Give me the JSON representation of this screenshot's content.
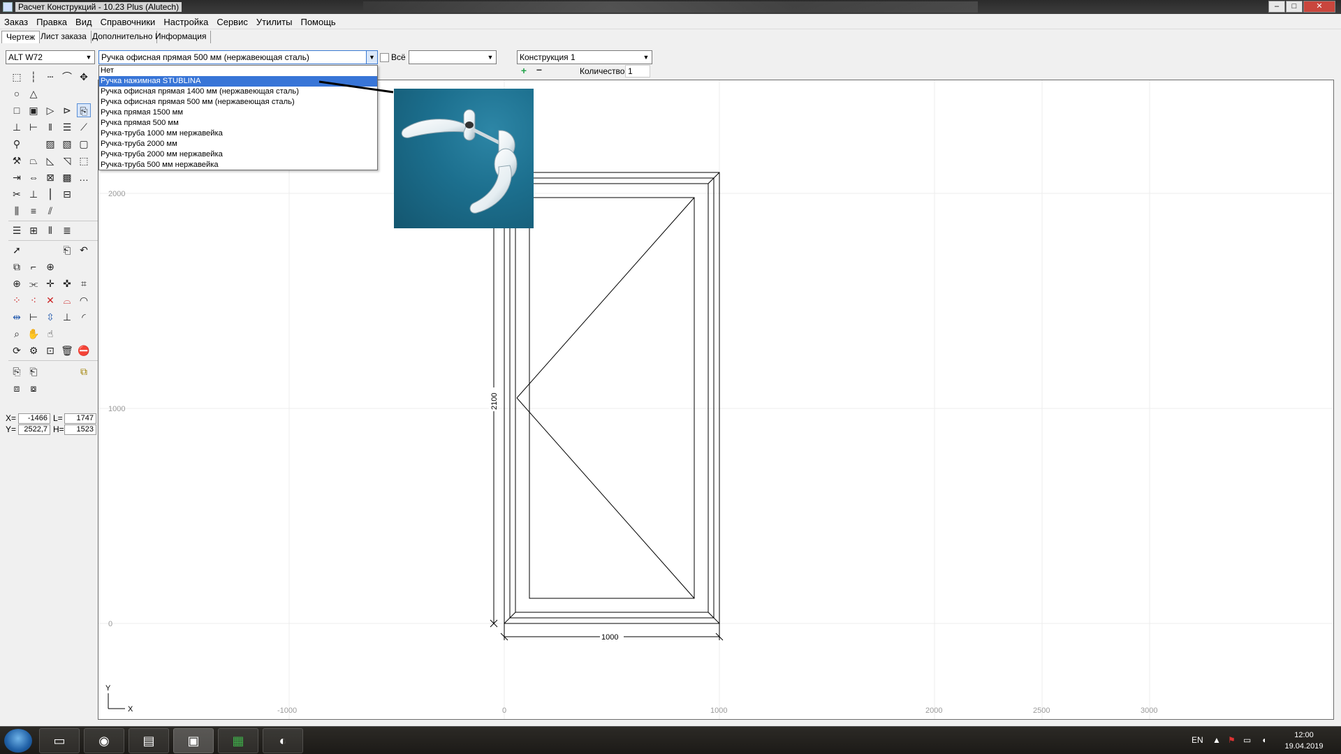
{
  "window": {
    "title": "Расчет Конструкций - 10.23 Plus (Alutech)",
    "min_glyph": "–",
    "max_glyph": "□",
    "close_glyph": "✕"
  },
  "menu": [
    "Заказ",
    "Правка",
    "Вид",
    "Справочники",
    "Настройка",
    "Сервис",
    "Утилиты",
    "Помощь"
  ],
  "tabs": [
    {
      "label": "Чертеж",
      "active": true
    },
    {
      "label": "Лист заказа",
      "active": false
    },
    {
      "label": "Дополнительно",
      "active": false
    },
    {
      "label": "Информация",
      "active": false
    }
  ],
  "toolbar": {
    "profile_system": "ALT W72",
    "handle_selected": "Ручка офисная прямая 500 мм (нержавеющая сталь)",
    "all_checkbox_label": "Всё",
    "all_checked": false,
    "empty_combo": "",
    "construction": "Конструкция 1",
    "quantity_label": "Количество",
    "quantity_value": "1"
  },
  "dropdown": {
    "items": [
      {
        "label": "Нет",
        "highlighted": false
      },
      {
        "label": "Ручка  нажимная STUBLINA",
        "highlighted": true
      },
      {
        "label": "Ручка офисная прямая 1400 мм (нержавеющая сталь)",
        "highlighted": false
      },
      {
        "label": "Ручка офисная прямая 500 мм (нержавеющая сталь)",
        "highlighted": false
      },
      {
        "label": "Ручка прямая 1500 мм",
        "highlighted": false
      },
      {
        "label": "Ручка прямая 500 мм",
        "highlighted": false
      },
      {
        "label": "Ручка-труба 1000 мм нержавейка",
        "highlighted": false
      },
      {
        "label": "Ручка-труба 2000 мм",
        "highlighted": false
      },
      {
        "label": "Ручка-труба 2000 мм нержавейка",
        "highlighted": false
      },
      {
        "label": "Ручка-труба 500 мм нержавейка",
        "highlighted": false
      }
    ]
  },
  "coords": {
    "x_label": "X=",
    "x_value": "-1466",
    "l_label": "L=",
    "l_value": "1747",
    "y_label": "Y=",
    "y_value": "2522,7",
    "h_label": "H=",
    "h_value": "1523"
  },
  "drawing": {
    "x_ticks": [
      "-1000",
      "0",
      "1000",
      "2000",
      "2500",
      "3000"
    ],
    "y_ticks": [
      "2000",
      "1000",
      "0"
    ],
    "width_dim": "1000",
    "height_dim": "2100",
    "axis_x": "X",
    "axis_y": "Y"
  },
  "taskbar": {
    "lang": "EN",
    "time": "12:00",
    "date": "19.04.2019"
  },
  "colors": {
    "highlight": "#3875d7",
    "preview_bg": "#1c6f8e",
    "taskbar": "#1c1a17"
  }
}
